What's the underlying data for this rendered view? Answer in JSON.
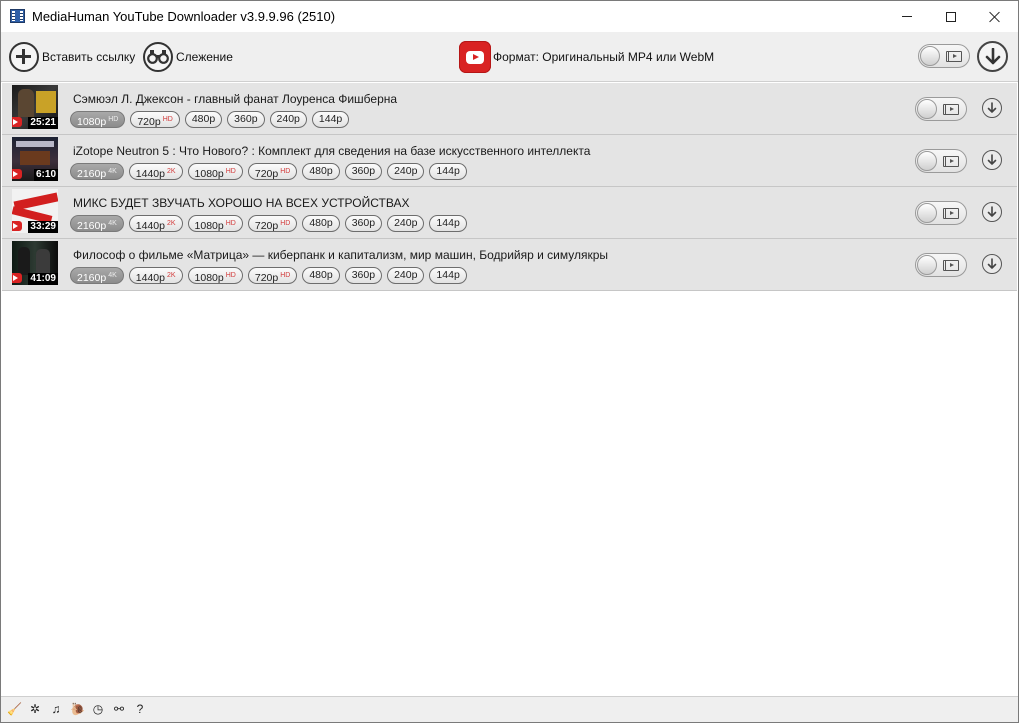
{
  "window": {
    "title": "MediaHuman YouTube Downloader v3.9.9.96 (2510)"
  },
  "toolbar": {
    "paste_label": "Вставить ссылку",
    "tracking_label": "Слежение",
    "format_label": "Формат: Оригинальный MP4 или WebM"
  },
  "videos": [
    {
      "title": "Сэмюэл Л. Джексон - главный фанат Лоуренса Фишберна",
      "duration": "25:21",
      "qualities": [
        {
          "label": "1080p",
          "badge": "HD",
          "selected": true
        },
        {
          "label": "720p",
          "badge": "HD",
          "selected": false
        },
        {
          "label": "480p",
          "badge": "",
          "selected": false
        },
        {
          "label": "360p",
          "badge": "",
          "selected": false
        },
        {
          "label": "240p",
          "badge": "",
          "selected": false
        },
        {
          "label": "144p",
          "badge": "",
          "selected": false
        }
      ]
    },
    {
      "title": "iZotope Neutron 5 : Что Нового? : Комплект для сведения на базе искусственного интеллекта",
      "duration": "6:10",
      "qualities": [
        {
          "label": "2160p",
          "badge": "4K",
          "selected": true
        },
        {
          "label": "1440p",
          "badge": "2K",
          "selected": false
        },
        {
          "label": "1080p",
          "badge": "HD",
          "selected": false
        },
        {
          "label": "720p",
          "badge": "HD",
          "selected": false
        },
        {
          "label": "480p",
          "badge": "",
          "selected": false
        },
        {
          "label": "360p",
          "badge": "",
          "selected": false
        },
        {
          "label": "240p",
          "badge": "",
          "selected": false
        },
        {
          "label": "144p",
          "badge": "",
          "selected": false
        }
      ]
    },
    {
      "title": "МИКС БУДЕТ ЗВУЧАТЬ ХОРОШО НА ВСЕХ УСТРОЙСТВАХ",
      "duration": "33:29",
      "qualities": [
        {
          "label": "2160p",
          "badge": "4K",
          "selected": true
        },
        {
          "label": "1440p",
          "badge": "2K",
          "selected": false
        },
        {
          "label": "1080p",
          "badge": "HD",
          "selected": false
        },
        {
          "label": "720p",
          "badge": "HD",
          "selected": false
        },
        {
          "label": "480p",
          "badge": "",
          "selected": false
        },
        {
          "label": "360p",
          "badge": "",
          "selected": false
        },
        {
          "label": "240p",
          "badge": "",
          "selected": false
        },
        {
          "label": "144p",
          "badge": "",
          "selected": false
        }
      ]
    },
    {
      "title": "Философ о фильме «Матрица» — киберпанк и капитализм, мир машин, Бодрийяр и симулякры",
      "duration": "41:09",
      "qualities": [
        {
          "label": "2160p",
          "badge": "4K",
          "selected": true
        },
        {
          "label": "1440p",
          "badge": "2K",
          "selected": false
        },
        {
          "label": "1080p",
          "badge": "HD",
          "selected": false
        },
        {
          "label": "720p",
          "badge": "HD",
          "selected": false
        },
        {
          "label": "480p",
          "badge": "",
          "selected": false
        },
        {
          "label": "360p",
          "badge": "",
          "selected": false
        },
        {
          "label": "240p",
          "badge": "",
          "selected": false
        },
        {
          "label": "144p",
          "badge": "",
          "selected": false
        }
      ]
    }
  ],
  "statusbar": {
    "icons": [
      "broom-icon",
      "gear-icon",
      "music-note-icon",
      "snail-icon",
      "clock-icon",
      "binoculars-icon",
      "help-icon"
    ],
    "glyphs": [
      "🧹",
      "✲",
      "♫",
      "🐌",
      "◷",
      "⚯",
      "?"
    ]
  },
  "colors": {
    "accent_red": "#d92323",
    "row_bg": "#e4e4e4",
    "selected_chip": "#8c8c8c"
  }
}
